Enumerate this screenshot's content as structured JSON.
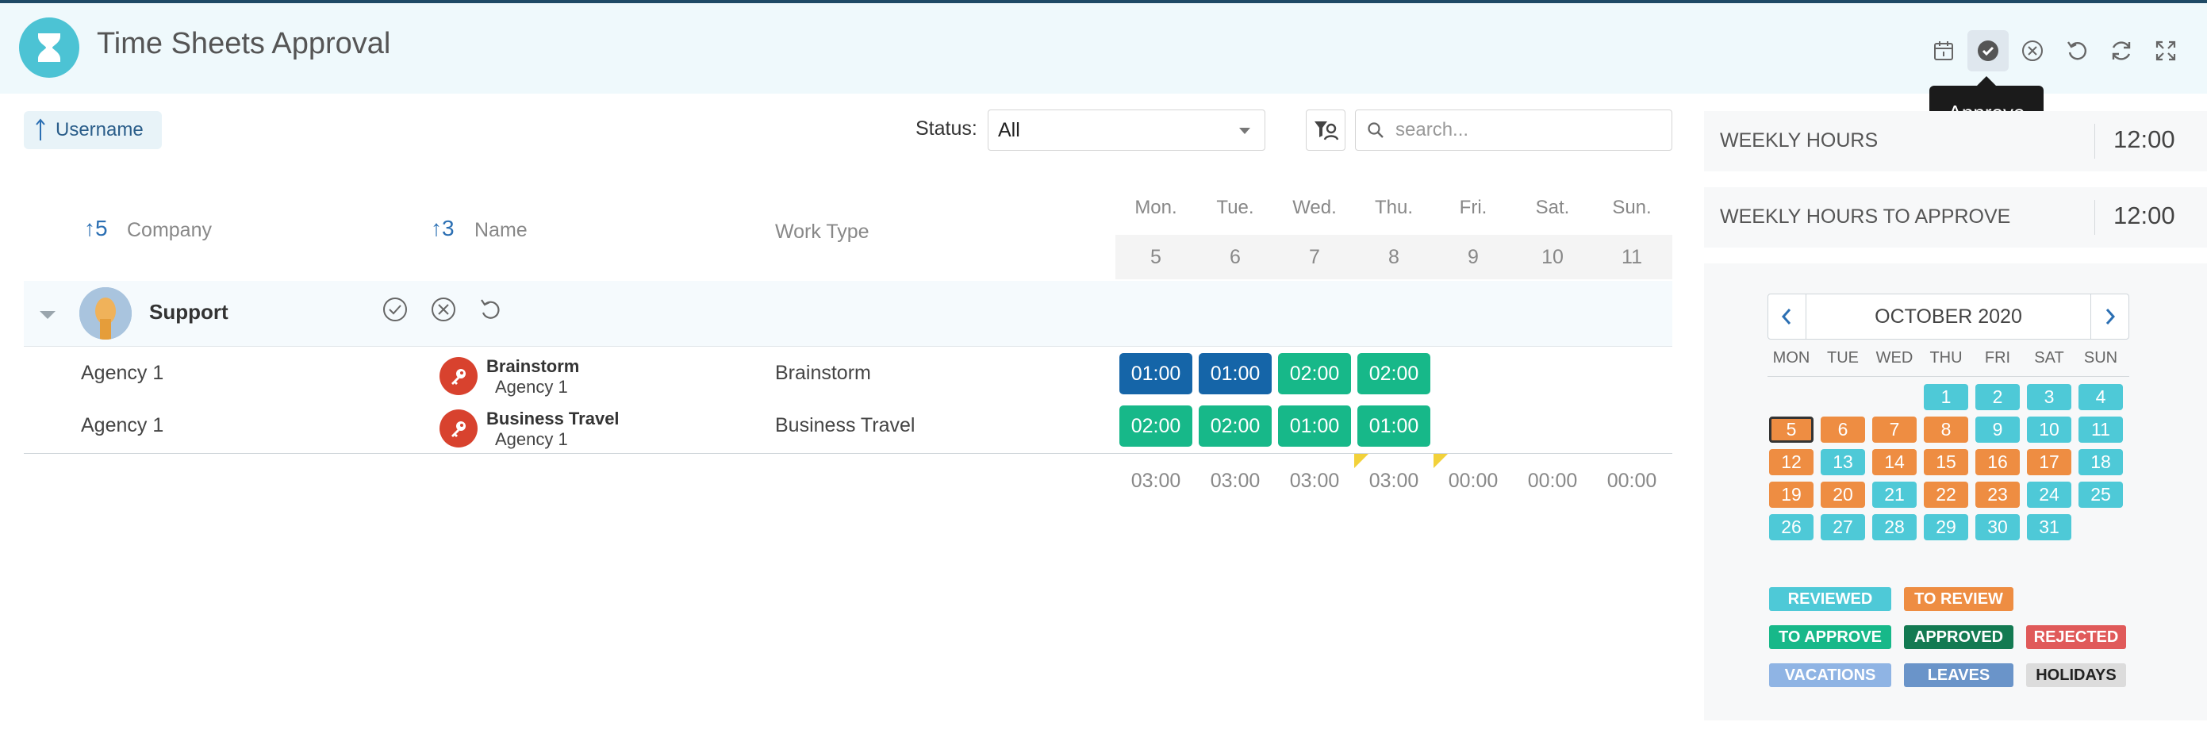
{
  "app": {
    "title": "Time Sheets Approval"
  },
  "toolbar": {
    "tooltip": "Approve"
  },
  "filters": {
    "sort_label": "Username",
    "status_label": "Status:",
    "status_value": "All",
    "search_placeholder": "search..."
  },
  "table": {
    "columns": [
      {
        "label": "Company",
        "sort": "5"
      },
      {
        "label": "Name",
        "sort": "3"
      },
      {
        "label": "Work Type"
      }
    ],
    "days": [
      {
        "name": "Mon.",
        "num": "5"
      },
      {
        "name": "Tue.",
        "num": "6"
      },
      {
        "name": "Wed.",
        "num": "7"
      },
      {
        "name": "Thu.",
        "num": "8"
      },
      {
        "name": "Fri.",
        "num": "9"
      },
      {
        "name": "Sat.",
        "num": "10"
      },
      {
        "name": "Sun.",
        "num": "11"
      }
    ],
    "group": {
      "name": "Support"
    },
    "rows": [
      {
        "company": "Agency 1",
        "title": "Brainstorm",
        "subtitle": "Agency 1",
        "work_type": "Brainstorm",
        "hours": [
          "01:00",
          "01:00",
          "02:00",
          "02:00"
        ],
        "hour_colors": [
          "#1565a8",
          "#1565a8",
          "#17b889",
          "#17b889"
        ]
      },
      {
        "company": "Agency 1",
        "title": "Business Travel",
        "subtitle": "Agency 1",
        "work_type": "Business Travel",
        "hours": [
          "02:00",
          "02:00",
          "01:00",
          "01:00"
        ],
        "hour_colors": [
          "#17b889",
          "#17b889",
          "#17b889",
          "#17b889"
        ]
      }
    ],
    "totals": [
      "03:00",
      "03:00",
      "03:00",
      "03:00",
      "00:00",
      "00:00",
      "00:00"
    ]
  },
  "summary": {
    "weekly_hours_label": "WEEKLY HOURS",
    "weekly_hours": "12:00",
    "weekly_to_approve_label": "WEEKLY HOURS TO APPROVE",
    "weekly_to_approve": "12:00"
  },
  "calendar": {
    "title": "OCTOBER 2020",
    "dow": [
      "MON",
      "TUE",
      "WED",
      "THU",
      "FRI",
      "SAT",
      "SUN"
    ],
    "weeks": [
      [
        null,
        null,
        null,
        "1",
        "2",
        "3",
        "4"
      ],
      [
        "5",
        "6",
        "7",
        "8",
        "9",
        "10",
        "11"
      ],
      [
        "12",
        "13",
        "14",
        "15",
        "16",
        "17",
        "18"
      ],
      [
        "19",
        "20",
        "21",
        "22",
        "23",
        "24",
        "25"
      ],
      [
        "26",
        "27",
        "28",
        "29",
        "30",
        "31",
        null
      ]
    ],
    "selected_day": "5",
    "status_by_day": {
      "1": "reviewed",
      "2": "reviewed",
      "3": "reviewed",
      "4": "reviewed",
      "5": "to-review",
      "6": "to-review",
      "7": "to-review",
      "8": "to-review",
      "9": "reviewed",
      "10": "reviewed",
      "11": "reviewed",
      "12": "to-review",
      "13": "reviewed",
      "14": "to-review",
      "15": "to-review",
      "16": "to-review",
      "17": "to-review",
      "18": "reviewed",
      "19": "to-review",
      "20": "to-review",
      "21": "reviewed",
      "22": "to-review",
      "23": "to-review",
      "24": "reviewed",
      "25": "reviewed",
      "26": "reviewed",
      "27": "reviewed",
      "28": "reviewed",
      "29": "reviewed",
      "30": "reviewed",
      "31": "reviewed"
    }
  },
  "legend": [
    {
      "label": "REVIEWED",
      "color": "#4ec9d7"
    },
    {
      "label": "TO REVIEW",
      "color": "#ee8d42"
    },
    {
      "label": "TO APPROVE",
      "color": "#17b889"
    },
    {
      "label": "APPROVED",
      "color": "#137a52"
    },
    {
      "label": "REJECTED",
      "color": "#e05a5a"
    },
    {
      "label": "VACATIONS",
      "color": "#8fb4e4"
    },
    {
      "label": "LEAVES",
      "color": "#6a94c9"
    },
    {
      "label": "HOLIDAYS",
      "color": "#dcdcdc"
    }
  ],
  "colors": {
    "accent": "#4cc3d4",
    "header_bg": "#eff9fc",
    "blue": "#1565a8",
    "green": "#17b889",
    "teal": "#4ec9d7",
    "orange": "#ee8d42"
  }
}
